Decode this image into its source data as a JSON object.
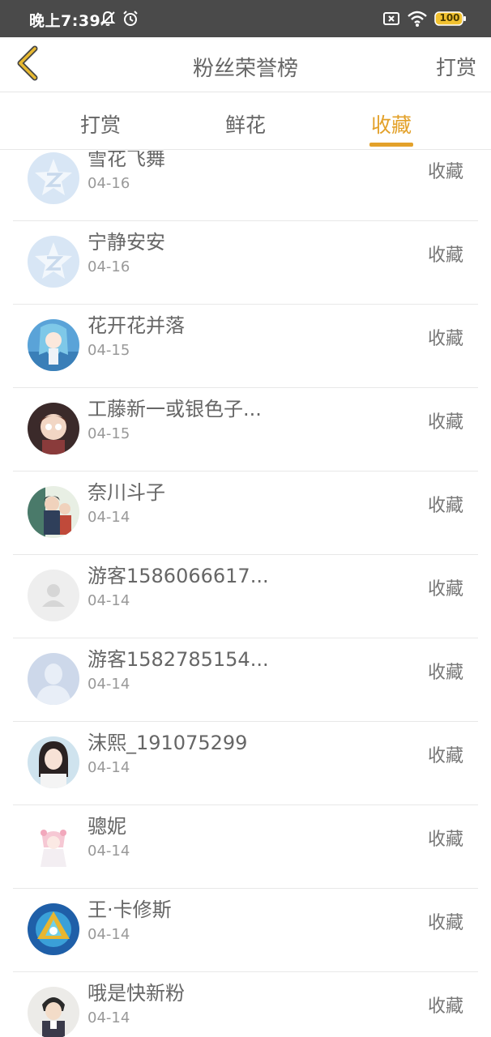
{
  "status_bar": {
    "time": "晚上7:39",
    "battery": "100"
  },
  "header": {
    "title": "粉丝荣誉榜",
    "action_label": "打赏"
  },
  "tabs": [
    {
      "label": "打赏",
      "active": false
    },
    {
      "label": "鲜花",
      "active": false
    },
    {
      "label": "收藏",
      "active": true
    }
  ],
  "fans": [
    {
      "name": "雪花飞舞",
      "date": "04-16",
      "action": "收藏",
      "avatar": "qq-star-avatar"
    },
    {
      "name": "宁静安安",
      "date": "04-16",
      "action": "收藏",
      "avatar": "qq-star-avatar"
    },
    {
      "name": "花开花并落",
      "date": "04-15",
      "action": "收藏",
      "avatar": "anime-avatar-blue"
    },
    {
      "name": "工藤新一或银色子...",
      "date": "04-15",
      "action": "收藏",
      "avatar": "anime-avatar-dark"
    },
    {
      "name": "奈川斗子",
      "date": "04-14",
      "action": "收藏",
      "avatar": "anime-avatar-green"
    },
    {
      "name": "游客1586066617...",
      "date": "04-14",
      "action": "收藏",
      "avatar": "default-gray-avatar"
    },
    {
      "name": "游客1582785154...",
      "date": "04-14",
      "action": "收藏",
      "avatar": "default-blue-avatar"
    },
    {
      "name": "沫熙_191075299",
      "date": "04-14",
      "action": "收藏",
      "avatar": "photo-avatar-girl"
    },
    {
      "name": "骢妮",
      "date": "04-14",
      "action": "收藏",
      "avatar": "anime-avatar-pink"
    },
    {
      "name": "王·卡修斯",
      "date": "04-14",
      "action": "收藏",
      "avatar": "game-avatar-gold"
    },
    {
      "name": "哦是快新粉",
      "date": "04-14",
      "action": "收藏",
      "avatar": "anime-avatar-boy"
    }
  ],
  "colors": {
    "accent": "#e3a12a",
    "status_bar_bg": "#4a4a4a"
  }
}
